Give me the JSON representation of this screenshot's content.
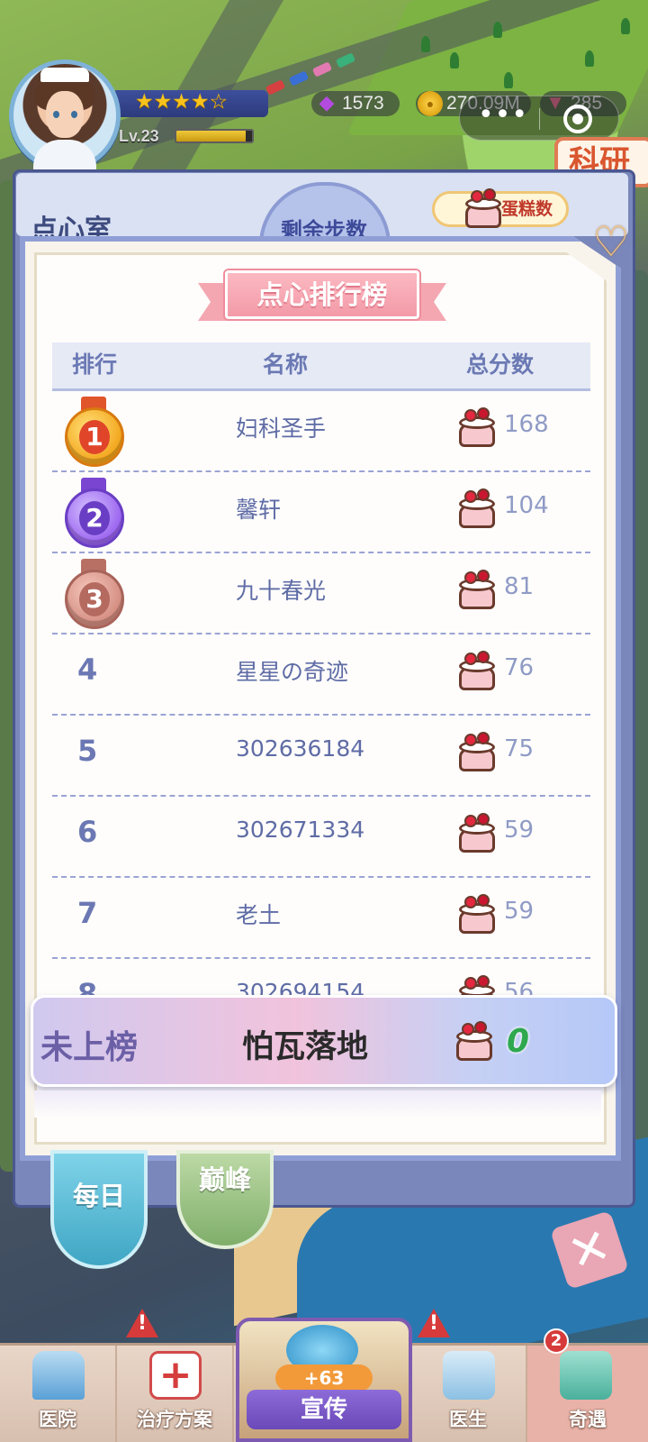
{
  "hud": {
    "level": "Lv.23",
    "level_progress": 0.92,
    "star_rating": 4.5,
    "stars_glyph": "★★★★☆",
    "gems": "1573",
    "coins": "270.09M",
    "crystals": "285",
    "menu_dots": "•••"
  },
  "background_panel": {
    "title": "点心室",
    "remaining_steps_label": "剩余步数",
    "cake_count_label": "蛋糕数",
    "side_sign_text": "科研"
  },
  "leaderboard": {
    "title": "点心排行榜",
    "columns": {
      "rank": "排行",
      "name": "名称",
      "score": "总分数"
    },
    "rows": [
      {
        "rank": "1",
        "name": "妇科圣手",
        "score": "168",
        "medal": "gold"
      },
      {
        "rank": "2",
        "name": "馨轩",
        "score": "104",
        "medal": "purple"
      },
      {
        "rank": "3",
        "name": "九十春光",
        "score": "81",
        "medal": "bronze"
      },
      {
        "rank": "4",
        "name": "星星の奇迹",
        "score": "76"
      },
      {
        "rank": "5",
        "name": "302636184",
        "score": "75"
      },
      {
        "rank": "6",
        "name": "302671334",
        "score": "59"
      },
      {
        "rank": "7",
        "name": "老土",
        "score": "59"
      },
      {
        "rank": "8",
        "name": "302694154",
        "score": "56"
      }
    ],
    "my_entry": {
      "rank_label": "未上榜",
      "name": "怕瓦落地",
      "score": "0"
    }
  },
  "tabs": {
    "daily": "每日",
    "peak": "巅峰"
  },
  "bottom_nav": {
    "hospital": "医院",
    "treatment": "治疗方案",
    "promote": "宣传",
    "promote_bonus": "+63",
    "doctor": "医生",
    "events": "奇遇",
    "events_badge": "2",
    "alert_mark": "!"
  },
  "colors": {
    "panel_border": "#8f9fd6",
    "header_text": "#6b79b4",
    "ribbon": "#f39aa8",
    "my_score_green": "#2fa84f"
  }
}
